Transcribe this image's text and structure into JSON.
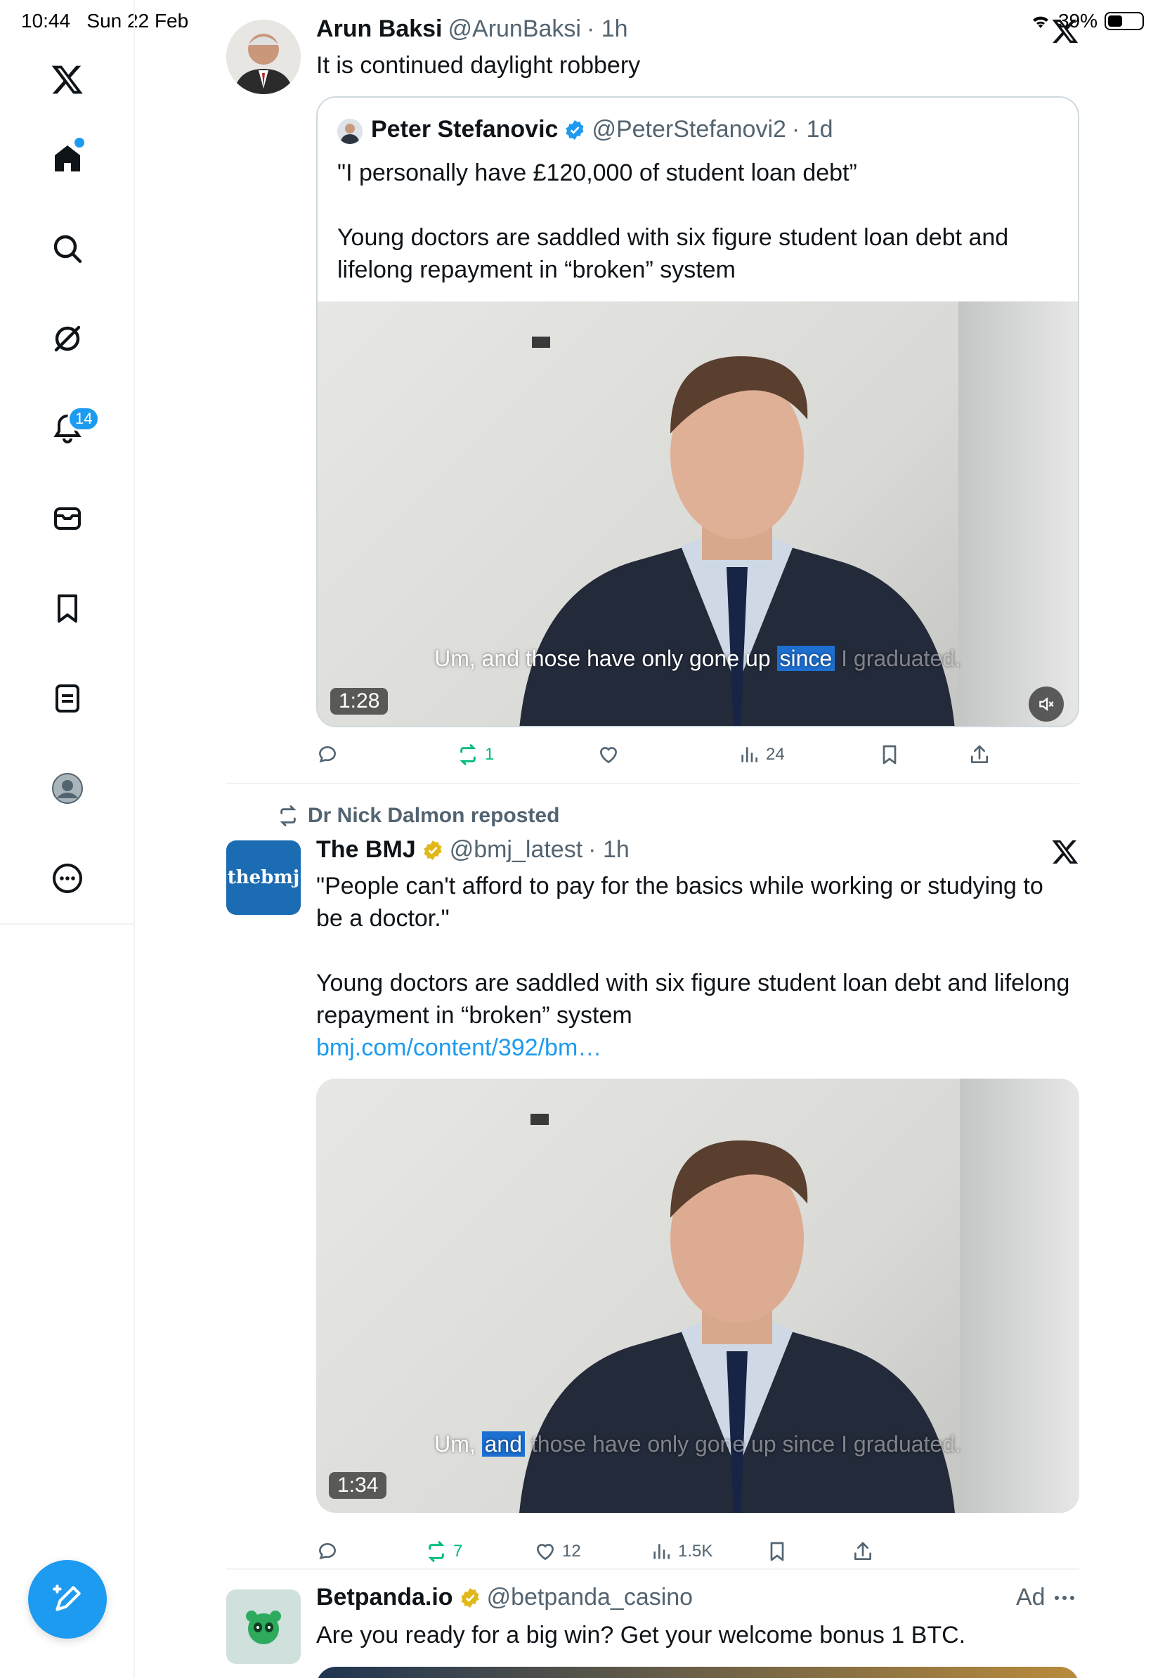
{
  "status_bar": {
    "time": "10:44",
    "date": "Sun 22 Feb",
    "battery": "39%"
  },
  "sidebar": {
    "notification_count": "14"
  },
  "posts": [
    {
      "author": "Arun Baksi",
      "handle": "@ArunBaksi",
      "time": "· 1h",
      "text": "It is continued daylight robbery",
      "quote": {
        "author": "Peter Stefanovic",
        "handle": "@PeterStefanovi2",
        "time": "· 1d",
        "text_line1": "\"I personally have £120,000 of student loan debt”",
        "text_line2": "Young doctors are saddled with six figure student loan debt and",
        "text_line3": "lifelong repayment in “broken” system",
        "video_duration": "1:28",
        "caption_pre": "Um, and those have only gone up ",
        "caption_hl": "since",
        "caption_post": " I graduated."
      },
      "stats": {
        "replies": "",
        "reposts": "1",
        "likes": "",
        "views": "24"
      }
    },
    {
      "repost_by": "Dr Nick Dalmon reposted",
      "author": "The BMJ",
      "handle": "@bmj_latest",
      "time": "· 1h",
      "avatar_text": "thebmj",
      "text_line1": "\"People can't afford to pay for the basics while working or studying to",
      "text_line2": "be a doctor.\"",
      "text_line3": "Young doctors are saddled with six figure student loan debt and lifelong",
      "text_line4": "repayment in “broken” system",
      "link": "bmj.com/content/392/bm…",
      "video_duration": "1:34",
      "caption_pre": "Um, ",
      "caption_hl": "and",
      "caption_post": " those have only gone up since I graduated.",
      "stats": {
        "replies": "",
        "reposts": "7",
        "likes": "12",
        "views": "1.5K"
      }
    },
    {
      "author": "Betpanda.io",
      "handle": "@betpanda_casino",
      "ad_label": "Ad",
      "text": "Are you ready for a big win? Get your welcome bonus 1 BTC."
    }
  ],
  "colors": {
    "accent": "#1d9bf0",
    "repost_green": "#00ba7c",
    "secondary_text": "#536471"
  }
}
